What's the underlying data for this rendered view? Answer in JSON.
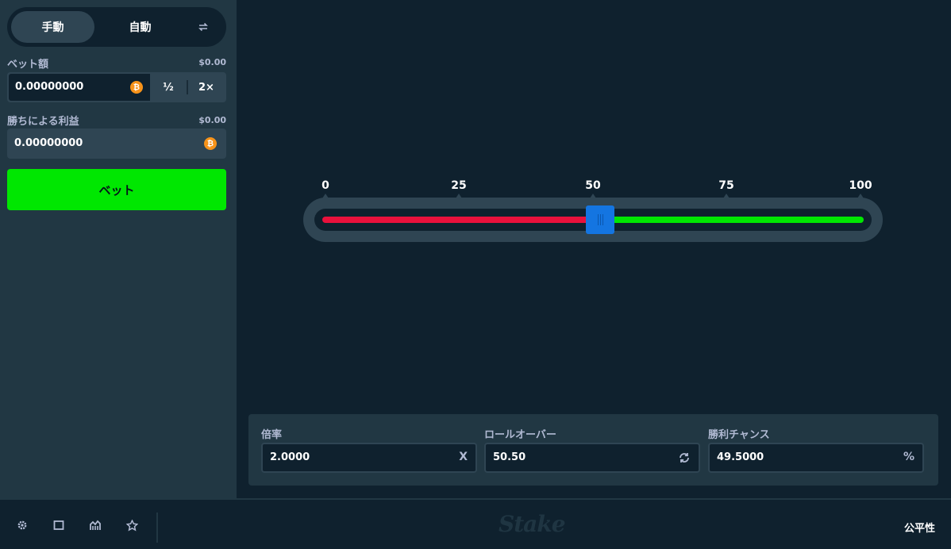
{
  "sidebar": {
    "tabs": {
      "manual": "手動",
      "auto": "自動"
    },
    "bet_amount": {
      "label": "ベット額",
      "usd": "$0.00",
      "value": "0.00000000",
      "half": "½",
      "double": "2×"
    },
    "profit": {
      "label": "勝ちによる利益",
      "usd": "$0.00",
      "value": "0.00000000"
    },
    "bet_button": "ベット",
    "coin_symbol": "₿"
  },
  "slider": {
    "ticks": [
      "0",
      "25",
      "50",
      "75",
      "100"
    ],
    "value": 50.5,
    "colors": {
      "lose": "#e9113c",
      "win": "#00e701",
      "thumb": "#1475e1"
    }
  },
  "stats": {
    "multiplier": {
      "label": "倍率",
      "value": "2.0000",
      "suffix": "X"
    },
    "roll_over": {
      "label": "ロールオーバー",
      "value": "50.50"
    },
    "win_chance": {
      "label": "勝利チャンス",
      "value": "49.5000",
      "suffix": "%"
    }
  },
  "footer": {
    "brand": "Stake",
    "fairness": "公平性"
  }
}
